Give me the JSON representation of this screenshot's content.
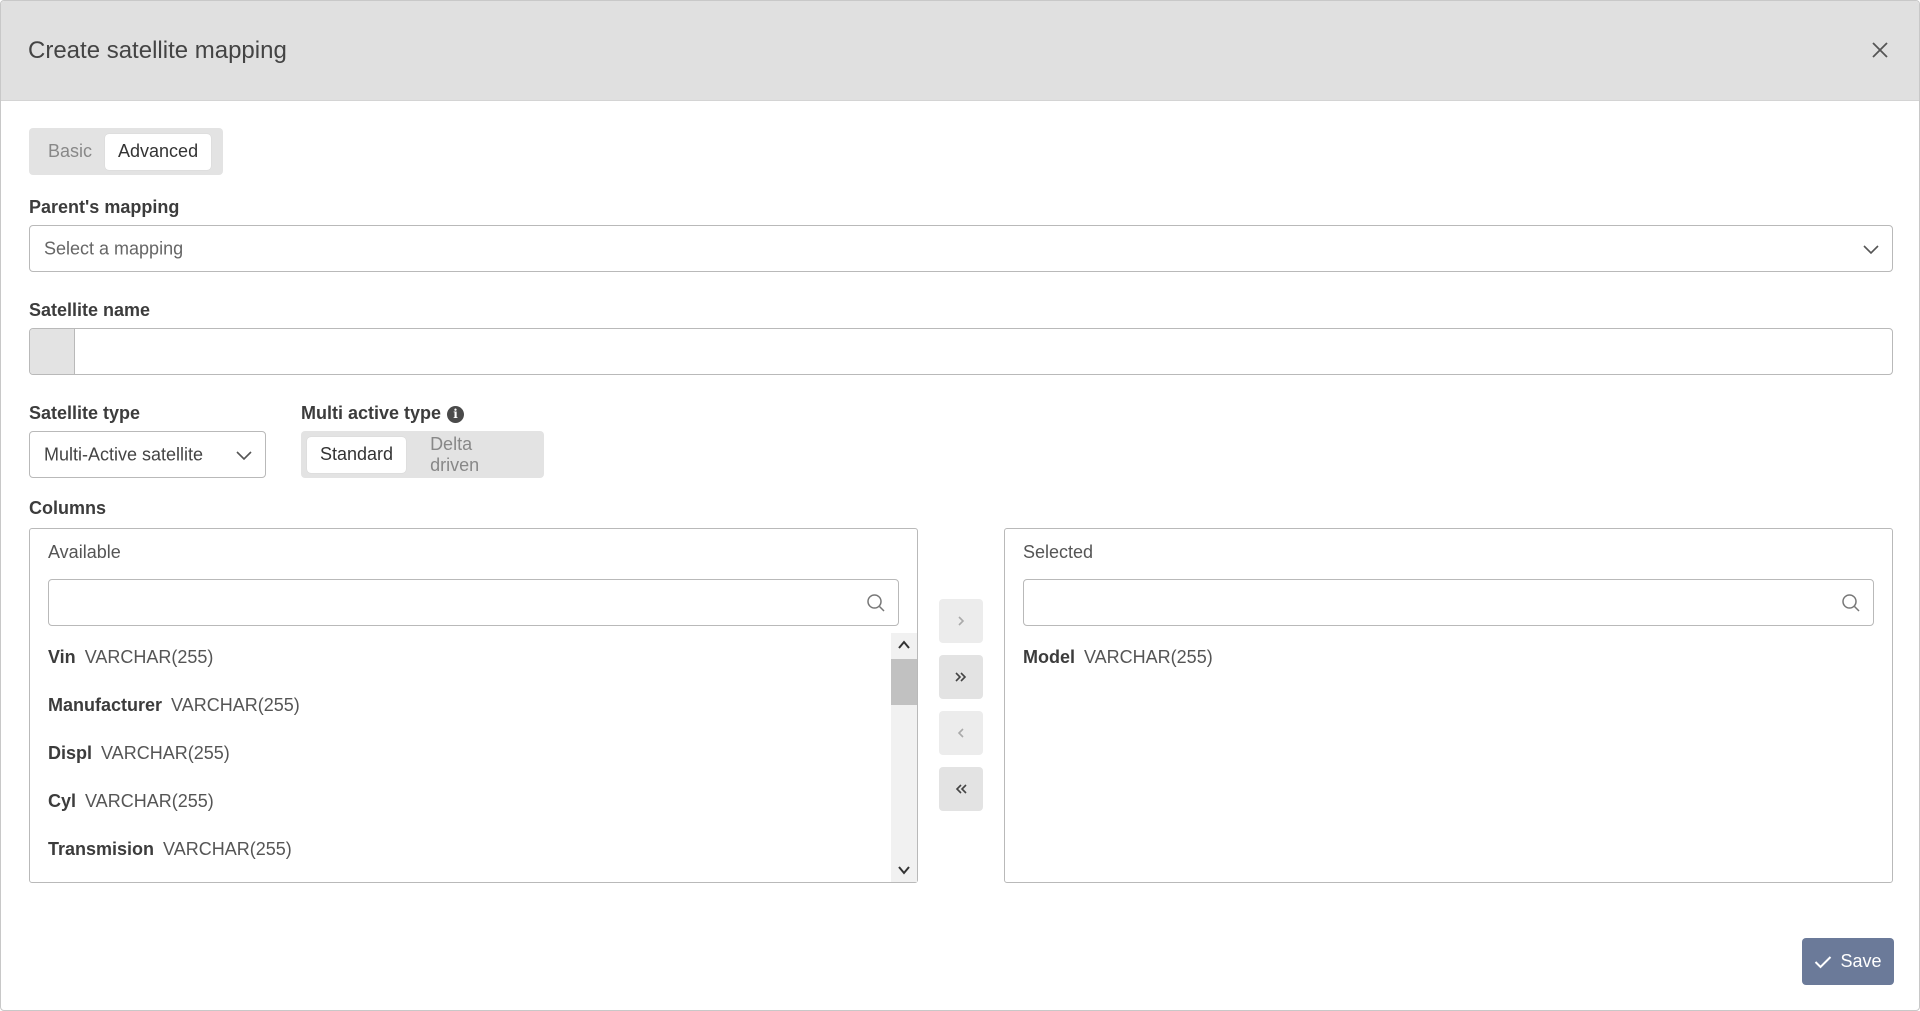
{
  "dialog": {
    "title": "Create satellite mapping"
  },
  "mode_tabs": [
    {
      "label": "Basic",
      "active": false
    },
    {
      "label": "Advanced",
      "active": true
    }
  ],
  "parent_mapping": {
    "label": "Parent's mapping",
    "placeholder": "Select a mapping"
  },
  "satellite_name": {
    "label": "Satellite name",
    "value": ""
  },
  "satellite_type": {
    "label": "Satellite type",
    "value": "Multi-Active satellite"
  },
  "multi_active_type": {
    "label": "Multi active type",
    "options": [
      {
        "label": "Standard",
        "active": true
      },
      {
        "label": "Delta driven",
        "active": false
      }
    ]
  },
  "columns": {
    "label": "Columns",
    "available": {
      "title": "Available",
      "search_value": "",
      "items": [
        {
          "name": "Vin",
          "type": "VARCHAR(255)"
        },
        {
          "name": "Manufacturer",
          "type": "VARCHAR(255)"
        },
        {
          "name": "Displ",
          "type": "VARCHAR(255)"
        },
        {
          "name": "Cyl",
          "type": "VARCHAR(255)"
        },
        {
          "name": "Transmision",
          "type": "VARCHAR(255)"
        }
      ]
    },
    "selected": {
      "title": "Selected",
      "search_value": "",
      "items": [
        {
          "name": "Model",
          "type": "VARCHAR(255)"
        }
      ]
    },
    "move_buttons": [
      {
        "icon": "chevron-right-icon",
        "glyph": "›",
        "enabled": false
      },
      {
        "icon": "double-chevron-right-icon",
        "glyph": "»",
        "enabled": true
      },
      {
        "icon": "chevron-left-icon",
        "glyph": "‹",
        "enabled": false
      },
      {
        "icon": "double-chevron-left-icon",
        "glyph": "«",
        "enabled": true
      }
    ]
  },
  "save_button": {
    "label": "Save"
  },
  "colors": {
    "header_bg": "#e0e0e0",
    "primary": "#6b7a99",
    "segment_bg": "#e3e3e3"
  }
}
